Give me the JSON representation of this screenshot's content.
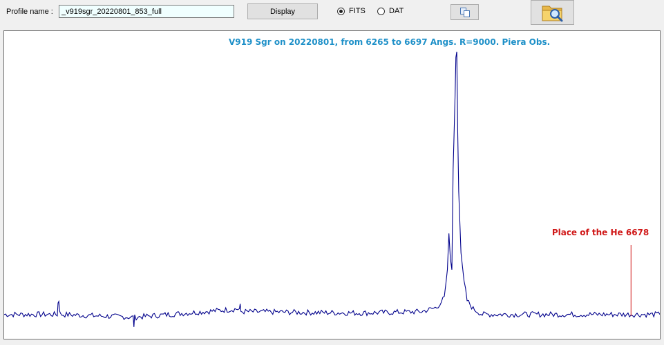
{
  "toolbar": {
    "profile_label": "Profile name :",
    "profile_value": "_v919sgr_20220801_853_full",
    "display_label": "Display",
    "radio_fits": "FITS",
    "radio_dat": "DAT",
    "selected_format": "FITS",
    "copy_icon": "copy-icon",
    "folder_search_icon": "folder-search-icon"
  },
  "colors": {
    "spectrum": "#00008b",
    "title": "#1e90c8",
    "annotation": "#d01818"
  },
  "chart_data": {
    "type": "line",
    "title": "V919 Sgr on 20220801, from 6265 to 6697 Angs. R=9000.   Piera Obs.",
    "xlabel": "",
    "ylabel": "",
    "xlim": [
      6265,
      6697
    ],
    "ylim": [
      0,
      1
    ],
    "grid": false,
    "series": [
      {
        "x": [
          6265,
          6300,
          6300.5,
          6301,
          6301.5,
          6302,
          6350,
          6350.5,
          6351,
          6420,
          6420.5,
          6421,
          6500,
          6540,
          6550,
          6555,
          6557,
          6558,
          6559,
          6560,
          6560.8,
          6561.3,
          6562.1,
          6562.6,
          6563.2,
          6563.8,
          6564.5,
          6566,
          6568,
          6570,
          6574,
          6580,
          6600,
          6650,
          6697
        ],
        "values": [
          0.06,
          0.06,
          0.1,
          0.11,
          0.08,
          0.06,
          0.05,
          0.02,
          0.05,
          0.08,
          0.09,
          0.07,
          0.065,
          0.07,
          0.085,
          0.12,
          0.22,
          0.35,
          0.26,
          0.22,
          0.58,
          0.68,
          0.85,
          0.98,
          1.0,
          0.72,
          0.5,
          0.28,
          0.18,
          0.11,
          0.08,
          0.06,
          0.06,
          0.06,
          0.06
        ]
      }
    ],
    "annotations": [
      {
        "text": "Place of the He 6678",
        "x": 6678
      }
    ]
  }
}
